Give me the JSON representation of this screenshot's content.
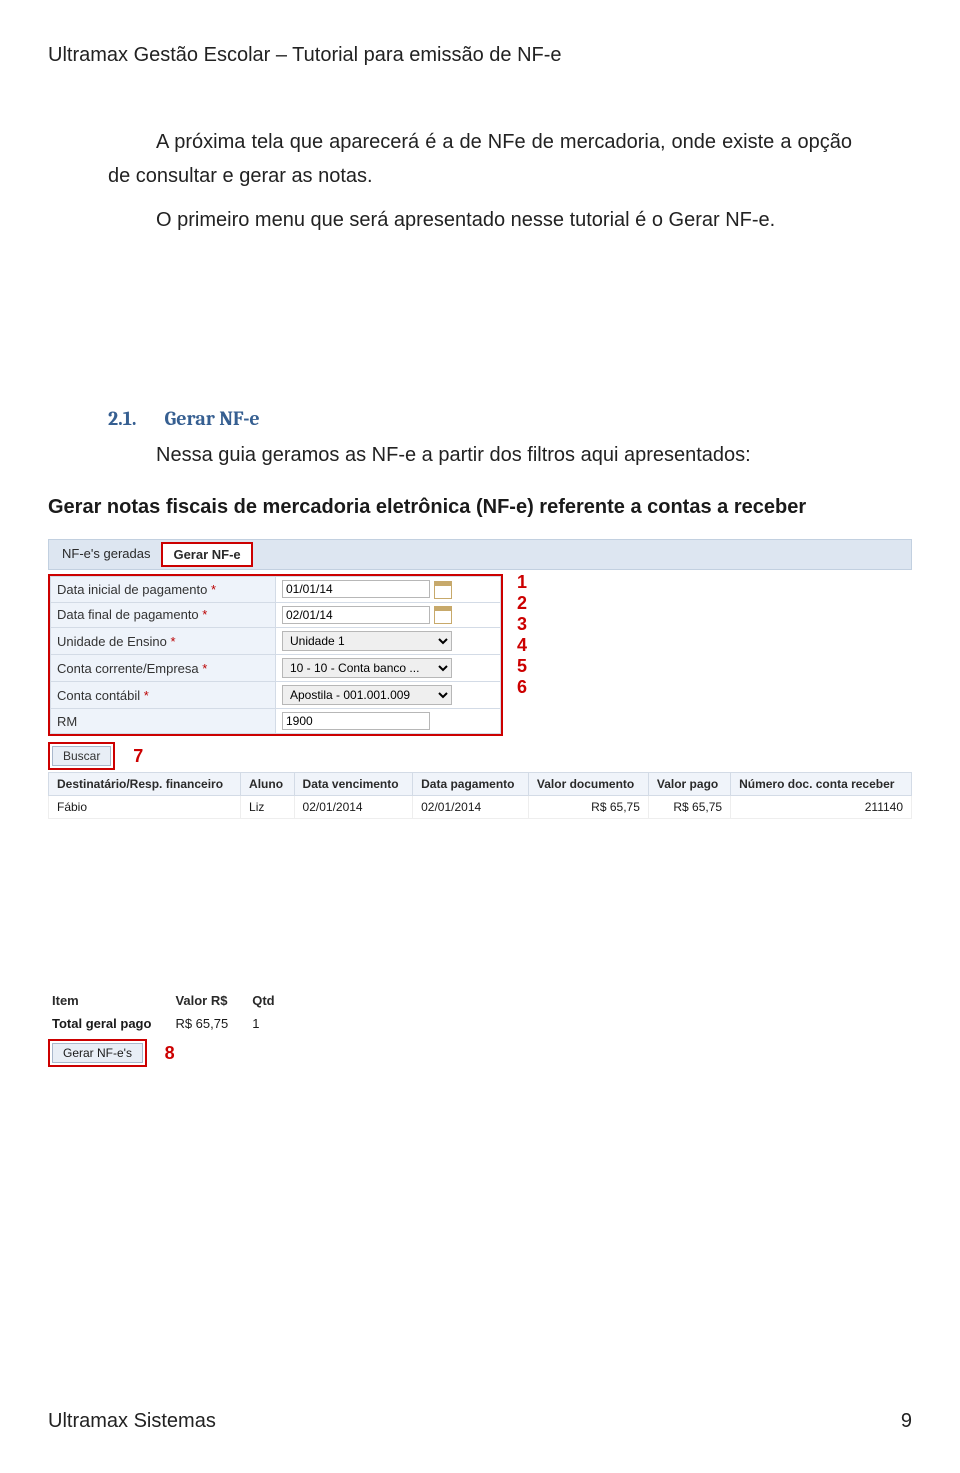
{
  "header": "Ultramax Gestão Escolar – Tutorial para emissão de NF-e",
  "para1": "A próxima tela que aparecerá é a de NFe de mercadoria, onde existe a opção de consultar e gerar as notas.",
  "para2": "O primeiro menu que será apresentado nesse tutorial é o Gerar NF-e.",
  "section": {
    "num": "2.1.",
    "title": "Gerar NF-e",
    "body": "Nessa guia geramos as NF-e a partir dos filtros aqui apresentados:"
  },
  "shot": {
    "title": "Gerar notas fiscais de mercadoria eletrônica (NF-e) referente a contas a receber",
    "tabs": {
      "inactive": "NF-e's geradas",
      "active": "Gerar NF-e"
    },
    "fields": [
      {
        "label": "Data inicial de pagamento",
        "req": true,
        "type": "date",
        "value": "01/01/14",
        "annot": "1"
      },
      {
        "label": "Data final de pagamento",
        "req": true,
        "type": "date",
        "value": "02/01/14",
        "annot": "2"
      },
      {
        "label": "Unidade de Ensino",
        "req": true,
        "type": "select",
        "value": "Unidade 1",
        "annot": "3"
      },
      {
        "label": "Conta corrente/Empresa",
        "req": true,
        "type": "select",
        "value": "10 - 10 - Conta banco ...",
        "annot": "4"
      },
      {
        "label": "Conta contábil",
        "req": true,
        "type": "select",
        "value": "Apostila - 001.001.009",
        "annot": "5"
      },
      {
        "label": "RM",
        "req": false,
        "type": "text",
        "value": "1900",
        "annot": "6"
      }
    ],
    "buscar": {
      "label": "Buscar",
      "annot": "7"
    },
    "grid": {
      "headers": [
        "Destinatário/Resp. financeiro",
        "Aluno",
        "Data vencimento",
        "Data pagamento",
        "Valor documento",
        "Valor pago",
        "Número doc. conta receber"
      ],
      "row": [
        "Fábio",
        "Liz",
        "02/01/2014",
        "02/01/2014",
        "R$ 65,75",
        "R$ 65,75",
        "211140"
      ]
    },
    "totals": {
      "headers": [
        "Item",
        "Valor R$",
        "Qtd"
      ],
      "label": "Total geral pago",
      "valor": "R$ 65,75",
      "qtd": "1"
    },
    "gerar": {
      "label": "Gerar NF-e's",
      "annot": "8"
    }
  },
  "footer": {
    "left": "Ultramax Sistemas",
    "right": "9"
  }
}
